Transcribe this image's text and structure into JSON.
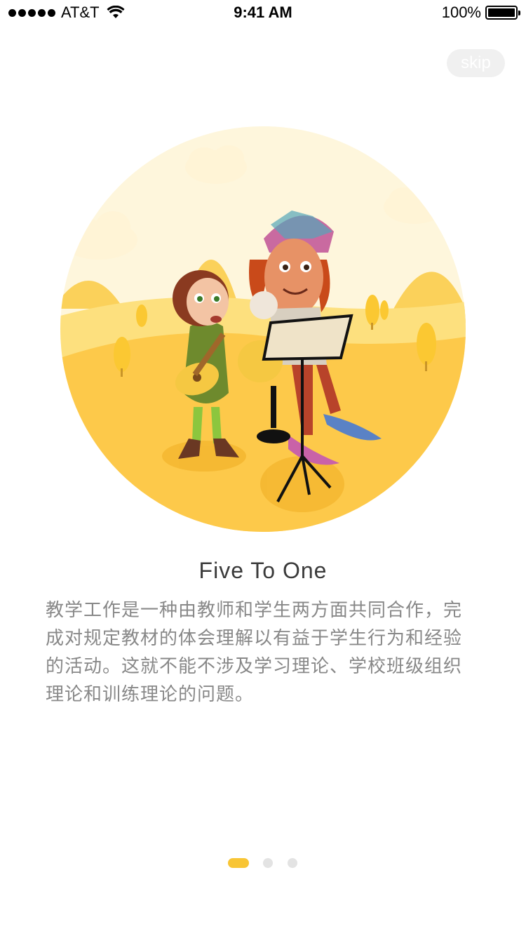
{
  "status_bar": {
    "carrier": "AT&T",
    "time": "9:41 AM",
    "battery": "100%"
  },
  "skip_label": "skip",
  "onboarding": {
    "title": "Five To One",
    "description": "教学工作是一种由教师和学生两方面共同合作，完成对规定教材的体会理解以有益于学生行为和经验的活动。这就不能不涉及学习理论、学校班级组织理论和训练理论的问题。"
  },
  "pager": {
    "total": 3,
    "active_index": 0
  },
  "colors": {
    "accent": "#f8c535",
    "illustration_bg": "#fef6dc",
    "ground": "#fdc94a",
    "dot_inactive": "#e3e3e3"
  },
  "icons": [
    "signal-dots-icon",
    "wifi-icon",
    "battery-icon"
  ]
}
